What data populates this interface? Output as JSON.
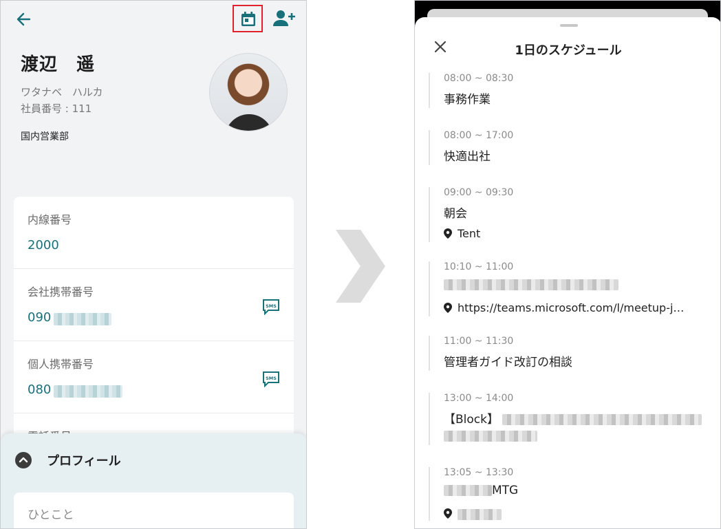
{
  "profile": {
    "name": "渡辺　遥",
    "kana": "ワタナベ　ハルカ",
    "employee_no": "社員番号 : 111",
    "department": "国内営業部"
  },
  "contacts": [
    {
      "label": "内線番号",
      "value": "2000"
    },
    {
      "label": "会社携帯番号",
      "value": "090"
    },
    {
      "label": "個人携帯番号",
      "value": "080"
    },
    {
      "label": "電話番号",
      "value": ""
    }
  ],
  "sms_label": "SMS",
  "profile_sheet": {
    "title": "プロフィール",
    "comment_label": "ひとこと"
  },
  "schedule": {
    "title": "1日のスケジュール",
    "events": [
      {
        "time": "08:00 ~ 08:30",
        "title": "事務作業",
        "location": ""
      },
      {
        "time": "08:00 ~ 17:00",
        "title": "快適出社",
        "location": ""
      },
      {
        "time": "09:00 ~ 09:30",
        "title": "朝会",
        "location": "Tent"
      },
      {
        "time": "10:10 ~ 11:00",
        "title": "",
        "location": "https://teams.microsoft.com/l/meetup-j…"
      },
      {
        "time": "11:00 ~ 11:30",
        "title": "管理者ガイド改訂の相談",
        "location": ""
      },
      {
        "time": "13:00 ~ 14:00",
        "title": "【Block】",
        "location": ""
      },
      {
        "time": "13:05 ~ 13:30",
        "title": "MTG",
        "location": ""
      }
    ]
  },
  "colors": {
    "accent_teal": "#17707a",
    "highlight_red": "#e0202a"
  }
}
